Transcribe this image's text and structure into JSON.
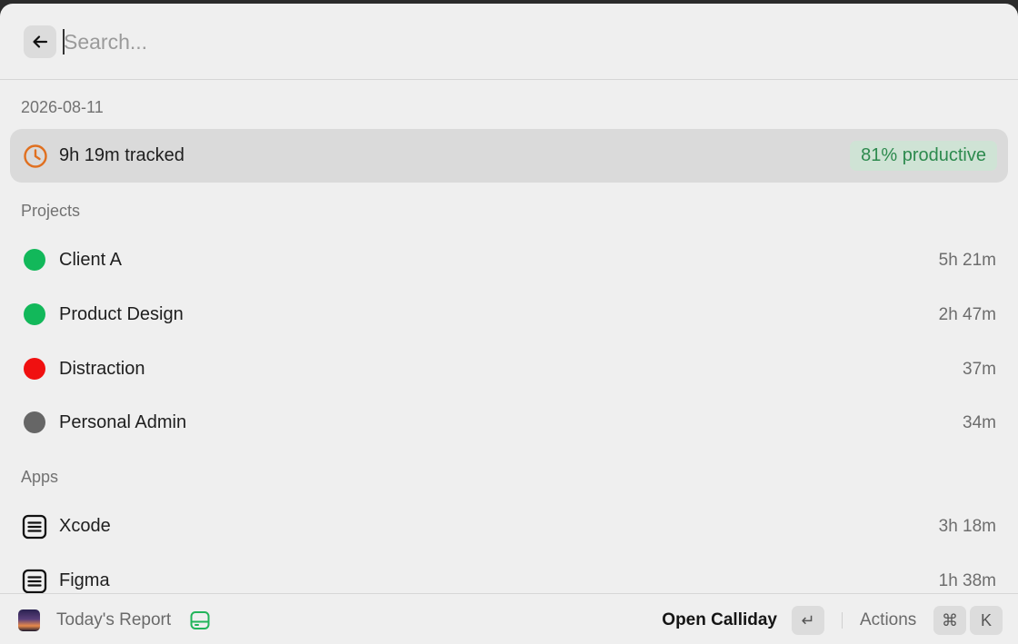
{
  "search": {
    "placeholder": "Search...",
    "value": ""
  },
  "date": "2026-08-11",
  "summary": {
    "tracked": "9h 19m tracked",
    "productivity": "81% productive",
    "productivity_fraction": 0.81
  },
  "sections": {
    "projects": "Projects",
    "apps": "Apps"
  },
  "projects": [
    {
      "name": "Client A",
      "time": "5h 21m",
      "color": "#12b85a"
    },
    {
      "name": "Product Design",
      "time": "2h 47m",
      "color": "#12b85a"
    },
    {
      "name": "Distraction",
      "time": "37m",
      "color": "#f01010"
    },
    {
      "name": "Personal Admin",
      "time": "34m",
      "color": "#666666"
    }
  ],
  "apps": [
    {
      "name": "Xcode",
      "time": "3h 18m",
      "icon": "list-icon"
    },
    {
      "name": "Figma",
      "time": "1h 38m",
      "icon": "list-icon"
    }
  ],
  "footer": {
    "report": "Today's Report",
    "open": "Open Calliday",
    "enter_key": "↵",
    "actions": "Actions",
    "cmd_key": "⌘",
    "k_key": "K"
  },
  "colors": {
    "accent_green": "#2d8a4e",
    "clock_orange": "#e07020"
  }
}
